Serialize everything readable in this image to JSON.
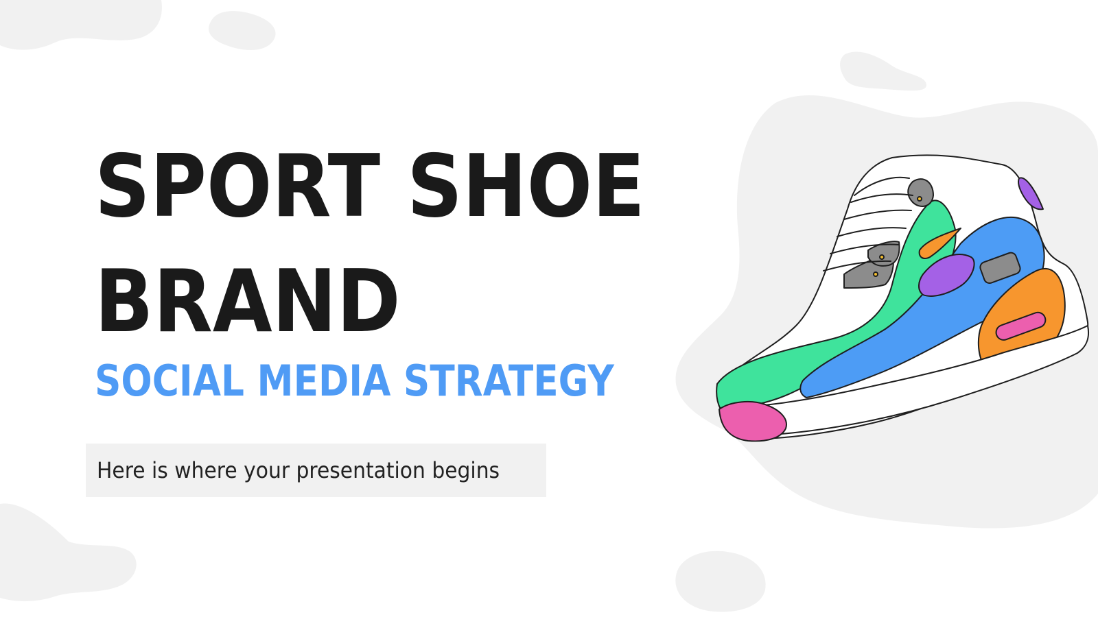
{
  "slide": {
    "title_lines": [
      "SPORT SHOE",
      "BRAND"
    ],
    "subtitle": "SOCIAL MEDIA STRATEGY",
    "tagline": "Here is where your presentation begins"
  },
  "colors": {
    "background": "#ffffff",
    "blob_gray": "#f1f1f1",
    "title": "#1a1a1a",
    "subtitle_accent": "#4f9bf5",
    "shoe_green": "#3fe39c",
    "shoe_blue": "#4d9cf5",
    "shoe_orange": "#f7962e",
    "shoe_pink": "#ec5fae",
    "shoe_purple": "#a461e6",
    "shoe_gray": "#8c8c8c"
  },
  "illustration": {
    "icon": "sneaker-illustration"
  }
}
